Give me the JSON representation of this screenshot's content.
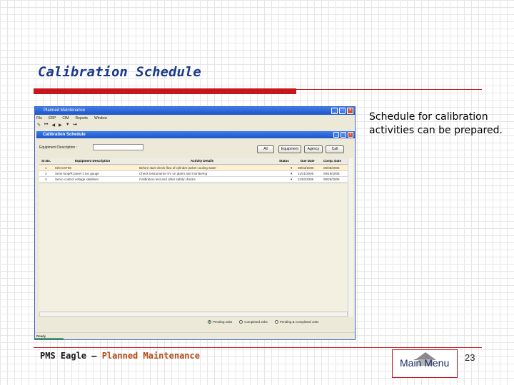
{
  "slide": {
    "title": "Calibration Schedule",
    "side_text": "Schedule for calibration activities can be prepared.",
    "footer_prefix": "PMS Eagle – ",
    "footer_accent": "Planned Maintenance",
    "main_menu_label": "Main Menu",
    "page_number": "23"
  },
  "colors": {
    "title": "#1b3a8a",
    "accent_red": "#c8161d",
    "footer_accent": "#b34a14",
    "xp_blue": "#1e55c8"
  },
  "icons": [
    "home-icon",
    "minimize-icon",
    "maximize-icon",
    "close-icon"
  ],
  "screenshot": {
    "window_title": "Planned Maintenance",
    "menu": [
      "File",
      "ERP",
      "CIM",
      "Reports",
      "Window"
    ],
    "inner_title": "Calibration Schedule",
    "equipment_label": "Equipment Description :",
    "buttons": {
      "all": "All",
      "equipment": "Equipment",
      "agency": "Agency",
      "call": "Call"
    },
    "columns": {
      "sr": "Sr.No.",
      "equipment": "Equipment Description",
      "activity": "Activity Details",
      "status": "Status",
      "due": "Due Date",
      "comp": "Comp. Date"
    },
    "rows": [
      {
        "sr": "1",
        "equipment": "M/S EXT80",
        "activity": "Before start check flow of cylinder jacket cooling water",
        "status": "",
        "due": "08/03/2006",
        "comp": "08/08/2006"
      },
      {
        "sr": "2",
        "equipment": "Sens-loop/R panel 1 ion gauge",
        "activity": "Check instruments mV on alarm and monitoring",
        "status": "",
        "due": "11/21/2005",
        "comp": "09/15/2006"
      },
      {
        "sr": "3",
        "equipment": "Servo control voltage stabiliser",
        "activity": "Calibration test and other safety checks",
        "status": "",
        "due": "11/04/2006",
        "comp": "08/26/2006"
      }
    ],
    "radios": {
      "pending": "Pending Jobs",
      "completed": "Completed Jobs",
      "both": "Pending & Completed Jobs"
    },
    "status_text": "Ready"
  }
}
